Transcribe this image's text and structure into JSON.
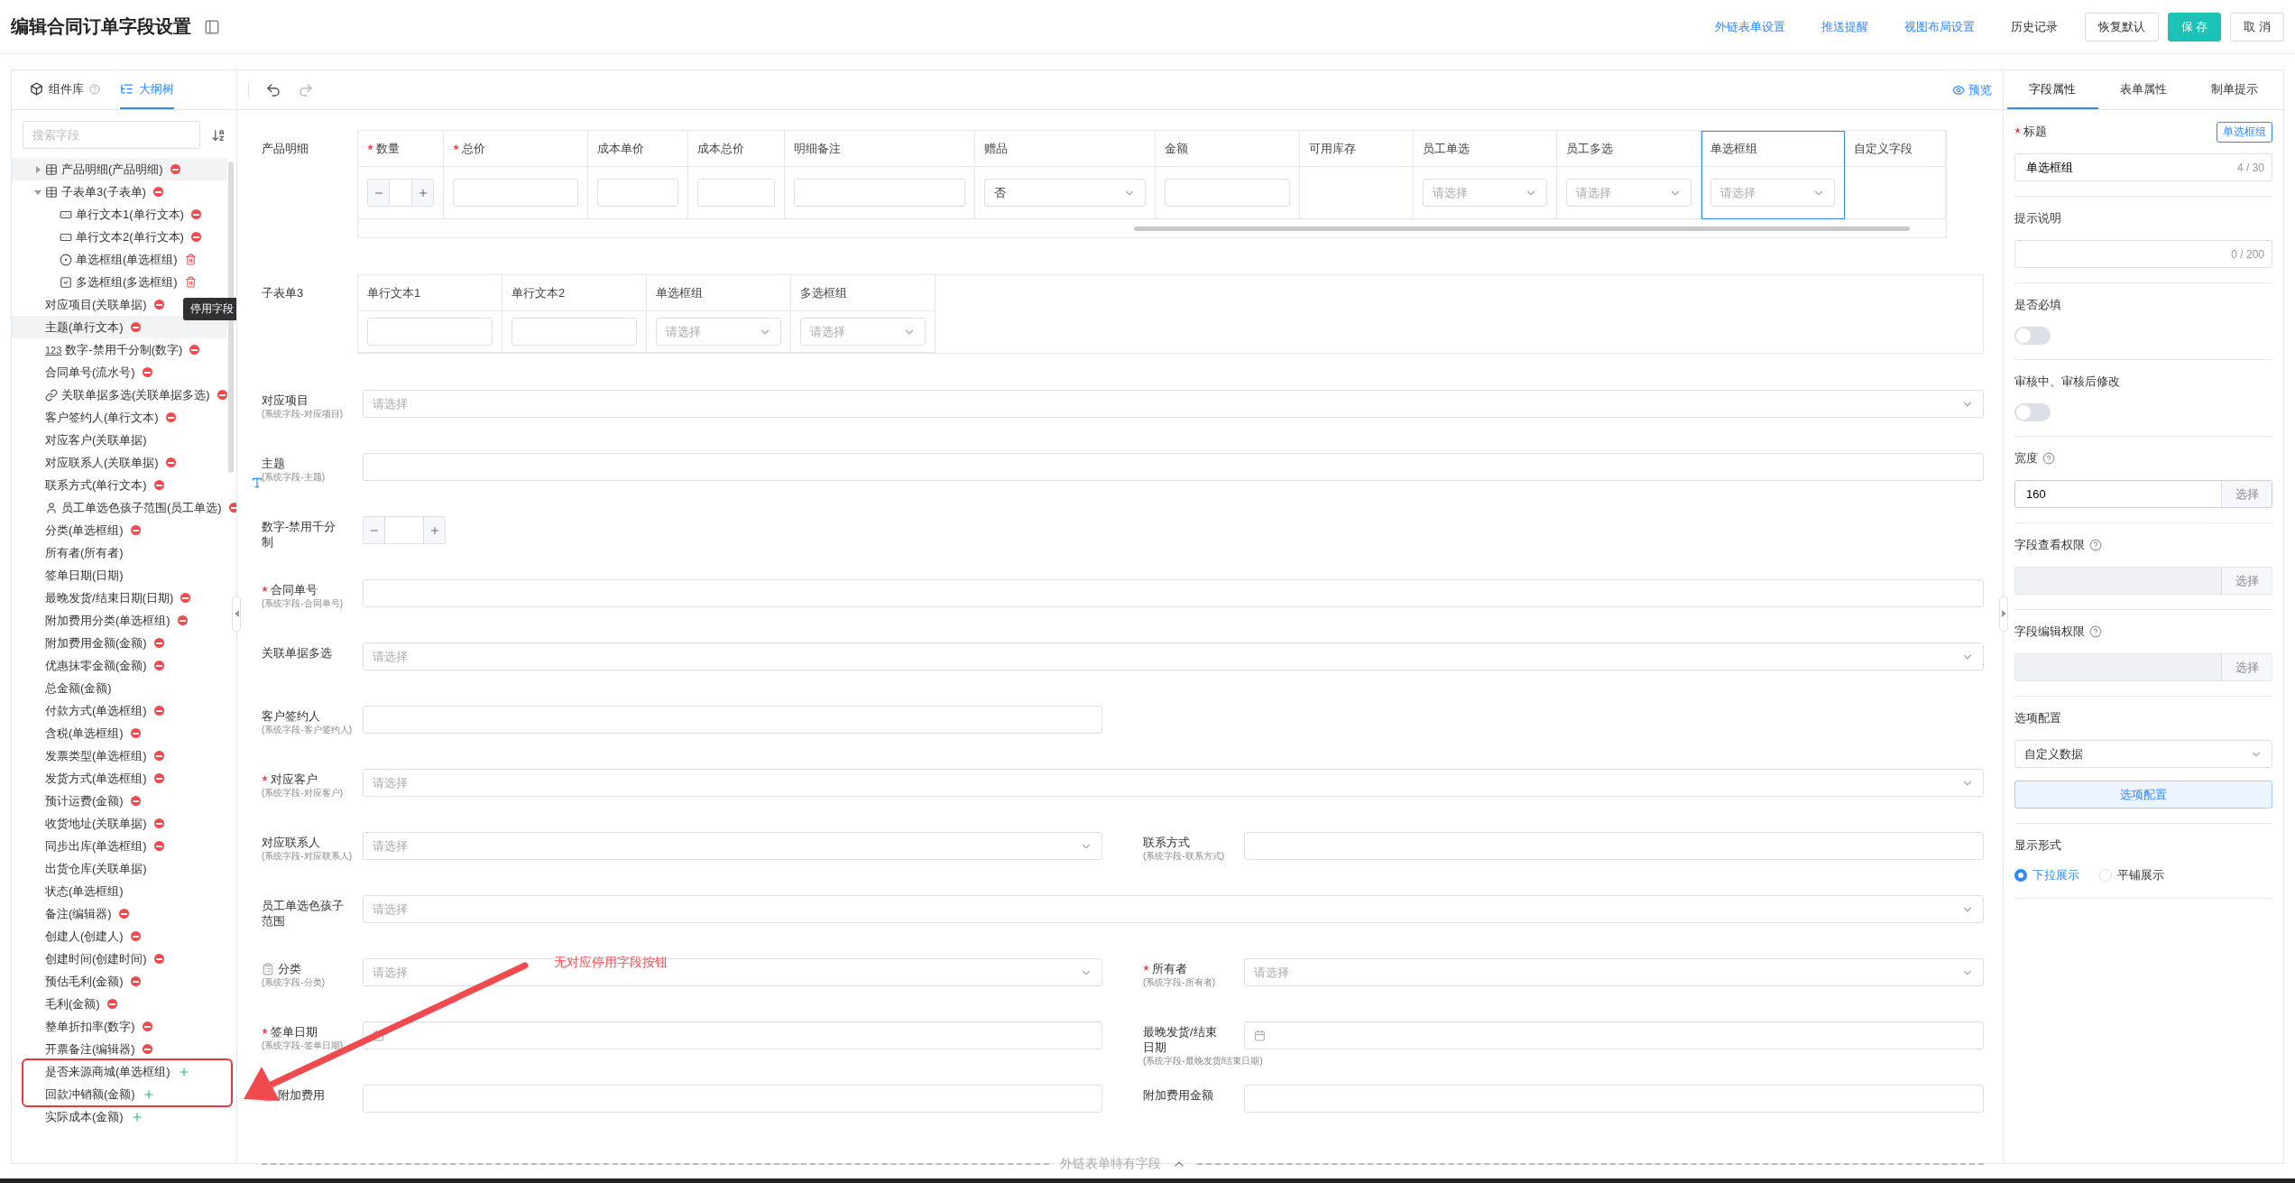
{
  "header": {
    "title": "编辑合同订单字段设置",
    "links": [
      "外链表单设置",
      "推送提醒",
      "视图布局设置"
    ],
    "history": "历史记录",
    "buttons": [
      {
        "label": "恢复默认",
        "kind": "default"
      },
      {
        "label": "保 存",
        "kind": "primary"
      },
      {
        "label": "取 消",
        "kind": "default"
      }
    ]
  },
  "left_panel": {
    "tabs": [
      {
        "label": "组件库",
        "selected": false,
        "help": true
      },
      {
        "label": "大纲树",
        "selected": true,
        "help": false
      }
    ],
    "search": {
      "placeholder": "搜索字段"
    },
    "tree": [
      {
        "label": "产品明细(产品明细)",
        "kind": "table",
        "action": {
          "kind": "disable"
        },
        "highlighted": true,
        "boxed": false,
        "expanded": false
      },
      {
        "label": "子表单3(子表单)",
        "kind": "table",
        "action": {
          "kind": "disable"
        },
        "highlighted": false,
        "boxed": false,
        "expanded": true,
        "children": [
          {
            "label": "单行文本1(单行文本)",
            "kind": "text",
            "action": {
              "kind": "disable"
            },
            "highlighted": false,
            "boxed": false
          },
          {
            "label": "单行文本2(单行文本)",
            "kind": "text",
            "action": {
              "kind": "disable"
            },
            "highlighted": false,
            "boxed": false
          },
          {
            "label": "单选框组(单选框组)",
            "kind": "radio",
            "action": {
              "kind": "delete"
            },
            "highlighted": false,
            "boxed": false
          },
          {
            "label": "多选框组(多选框组)",
            "kind": "checkbox",
            "action": {
              "kind": "delete"
            },
            "highlighted": false,
            "boxed": false
          }
        ]
      },
      {
        "label": "对应项目(关联单据)",
        "kind": "plain",
        "action": {
          "kind": "disable"
        },
        "highlighted": false,
        "boxed": false
      },
      {
        "label": "主题(单行文本)",
        "kind": "plain",
        "action": {
          "kind": "disable"
        },
        "highlighted": true,
        "boxed": false,
        "tooltip": "停用字段"
      },
      {
        "label": "数字-禁用千分制(数字)",
        "kind": "number",
        "glyph": "123",
        "action": {
          "kind": "disable"
        },
        "highlighted": false,
        "boxed": false
      },
      {
        "label": "合同单号(流水号)",
        "kind": "plain",
        "action": {
          "kind": "disable"
        },
        "highlighted": false,
        "boxed": false
      },
      {
        "label": "关联单据多选(关联单据多选)",
        "kind": "link",
        "action": {
          "kind": "disable"
        },
        "highlighted": false,
        "boxed": false
      },
      {
        "label": "客户签约人(单行文本)",
        "kind": "plain",
        "action": {
          "kind": "disable"
        },
        "highlighted": false,
        "boxed": false
      },
      {
        "label": "对应客户(关联单据)",
        "kind": "plain",
        "highlighted": false,
        "boxed": false
      },
      {
        "label": "对应联系人(关联单据)",
        "kind": "plain",
        "action": {
          "kind": "disable"
        },
        "highlighted": false,
        "boxed": false
      },
      {
        "label": "联系方式(单行文本)",
        "kind": "plain",
        "action": {
          "kind": "disable"
        },
        "highlighted": false,
        "boxed": false
      },
      {
        "label": "员工单选色孩子范围(员工单选)",
        "kind": "user",
        "action": {
          "kind": "disable"
        },
        "highlighted": false,
        "boxed": false
      },
      {
        "label": "分类(单选框组)",
        "kind": "plain",
        "action": {
          "kind": "disable"
        },
        "highlighted": false,
        "boxed": false
      },
      {
        "label": "所有者(所有者)",
        "kind": "plain",
        "highlighted": false,
        "boxed": false
      },
      {
        "label": "签单日期(日期)",
        "kind": "plain",
        "highlighted": false,
        "boxed": false
      },
      {
        "label": "最晚发货/结束日期(日期)",
        "kind": "plain",
        "action": {
          "kind": "disable"
        },
        "highlighted": false,
        "boxed": false
      },
      {
        "label": "附加费用分类(单选框组)",
        "kind": "plain",
        "action": {
          "kind": "disable"
        },
        "highlighted": false,
        "boxed": false
      },
      {
        "label": "附加费用金额(金额)",
        "kind": "plain",
        "action": {
          "kind": "disable"
        },
        "highlighted": false,
        "boxed": false
      },
      {
        "label": "优惠抹零金额(金额)",
        "kind": "plain",
        "action": {
          "kind": "disable"
        },
        "highlighted": false,
        "boxed": false
      },
      {
        "label": "总金额(金额)",
        "kind": "plain",
        "highlighted": false,
        "boxed": false
      },
      {
        "label": "付款方式(单选框组)",
        "kind": "plain",
        "action": {
          "kind": "disable"
        },
        "highlighted": false,
        "boxed": false
      },
      {
        "label": "含税(单选框组)",
        "kind": "plain",
        "action": {
          "kind": "disable"
        },
        "highlighted": false,
        "boxed": false
      },
      {
        "label": "发票类型(单选框组)",
        "kind": "plain",
        "action": {
          "kind": "disable"
        },
        "highlighted": false,
        "boxed": false
      },
      {
        "label": "发货方式(单选框组)",
        "kind": "plain",
        "action": {
          "kind": "disable"
        },
        "highlighted": false,
        "boxed": false
      },
      {
        "label": "预计运费(金额)",
        "kind": "plain",
        "action": {
          "kind": "disable"
        },
        "highlighted": false,
        "boxed": false
      },
      {
        "label": "收货地址(关联单据)",
        "kind": "plain",
        "action": {
          "kind": "disable"
        },
        "highlighted": false,
        "boxed": false
      },
      {
        "label": "同步出库(单选框组)",
        "kind": "plain",
        "action": {
          "kind": "disable"
        },
        "highlighted": false,
        "boxed": false
      },
      {
        "label": "出货仓库(关联单据)",
        "kind": "plain",
        "highlighted": false,
        "boxed": false
      },
      {
        "label": "状态(单选框组)",
        "kind": "plain",
        "highlighted": false,
        "boxed": false
      },
      {
        "label": "备注(编辑器)",
        "kind": "plain",
        "action": {
          "kind": "disable"
        },
        "highlighted": false,
        "boxed": false
      },
      {
        "label": "创建人(创建人)",
        "kind": "plain",
        "action": {
          "kind": "disable"
        },
        "highlighted": false,
        "boxed": false
      },
      {
        "label": "创建时间(创建时间)",
        "kind": "plain",
        "action": {
          "kind": "disable"
        },
        "highlighted": false,
        "boxed": false
      },
      {
        "label": "预估毛利(金额)",
        "kind": "plain",
        "action": {
          "kind": "disable"
        },
        "highlighted": false,
        "boxed": false
      },
      {
        "label": "毛利(金额)",
        "kind": "plain",
        "action": {
          "kind": "disable"
        },
        "highlighted": false,
        "boxed": false
      },
      {
        "label": "整单折扣率(数字)",
        "kind": "plain",
        "action": {
          "kind": "disable"
        },
        "highlighted": false,
        "boxed": false
      },
      {
        "label": "开票备注(编辑器)",
        "kind": "plain",
        "action": {
          "kind": "disable"
        },
        "highlighted": false,
        "boxed": false
      },
      {
        "label": "是否来源商城(单选框组)",
        "kind": "plain",
        "action": {
          "kind": "enable"
        },
        "highlighted": false,
        "boxed": true
      },
      {
        "label": "回款冲销额(金额)",
        "kind": "plain",
        "action": {
          "kind": "enable"
        },
        "highlighted": false,
        "boxed": true
      },
      {
        "label": "实际成本(金额)",
        "kind": "plain",
        "action": {
          "kind": "enable"
        },
        "highlighted": false,
        "boxed": false
      }
    ]
  },
  "center": {
    "preview": "预览",
    "product_table": {
      "label": "产品明细",
      "columns": [
        {
          "label": "数量",
          "required": true,
          "kind": "stepper",
          "selected": false
        },
        {
          "label": "总价",
          "required": true,
          "kind": "input",
          "selected": false
        },
        {
          "label": "成本单价",
          "required": false,
          "kind": "input",
          "selected": false
        },
        {
          "label": "成本总价",
          "required": false,
          "kind": "input",
          "selected": false
        },
        {
          "label": "明细备注",
          "required": false,
          "kind": "input",
          "selected": false
        },
        {
          "label": "赠品",
          "required": false,
          "kind": "select",
          "value": "否",
          "selected": false
        },
        {
          "label": "金额",
          "required": false,
          "kind": "input",
          "selected": false
        },
        {
          "label": "可用库存",
          "required": false,
          "kind": "empty",
          "selected": false
        },
        {
          "label": "员工单选",
          "required": false,
          "kind": "select",
          "placeholder": "请选择",
          "selected": false
        },
        {
          "label": "员工多选",
          "required": false,
          "kind": "select",
          "placeholder": "请选择",
          "selected": false
        },
        {
          "label": "单选框组",
          "required": false,
          "kind": "select",
          "placeholder": "请选择",
          "selected": true
        },
        {
          "label": "自定义字段",
          "required": false,
          "kind": "empty",
          "selected": false
        }
      ]
    },
    "subtable": {
      "label": "子表单3",
      "columns": [
        {
          "label": "单行文本1",
          "required": false,
          "kind": "input",
          "selected": false
        },
        {
          "label": "单行文本2",
          "required": false,
          "kind": "input",
          "selected": false
        },
        {
          "label": "单选框组",
          "required": false,
          "kind": "select",
          "placeholder": "请选择",
          "selected": false
        },
        {
          "label": "多选框组",
          "required": false,
          "kind": "select",
          "placeholder": "请选择",
          "selected": false
        }
      ]
    },
    "rows": [
      {
        "fields": [
          {
            "label": "对应项目",
            "sublabel": "(系统字段-对应项目)",
            "required": false,
            "icon": false,
            "kind": "select",
            "placeholder": "请选择",
            "wide": true
          }
        ]
      },
      {
        "fields": [
          {
            "label": "主题",
            "sublabel": "(系统字段-主题)",
            "required": false,
            "icon": false,
            "kind": "input",
            "wide": true
          }
        ]
      },
      {
        "fields": [
          {
            "label": "数字-禁用千分制",
            "required": false,
            "icon": false,
            "kind": "stepper",
            "wide": true
          }
        ]
      },
      {
        "fields": [
          {
            "label": "合同单号",
            "sublabel": "(系统字段-合同单号)",
            "required": true,
            "icon": false,
            "kind": "input",
            "wide": true
          }
        ]
      },
      {
        "fields": [
          {
            "label": "关联单据多选",
            "required": false,
            "icon": false,
            "kind": "select",
            "placeholder": "请选择",
            "wide": true
          }
        ]
      },
      {
        "fields": [
          {
            "label": "客户签约人",
            "sublabel": "(系统字段-客户签约人)",
            "required": false,
            "icon": false,
            "kind": "input",
            "wide": false
          }
        ]
      },
      {
        "fields": [
          {
            "label": "对应客户",
            "sublabel": "(系统字段-对应客户)",
            "required": true,
            "icon": false,
            "kind": "select",
            "placeholder": "请选择",
            "wide": true
          }
        ]
      },
      {
        "fields": [
          {
            "label": "对应联系人",
            "sublabel": "(系统字段-对应联系人)",
            "required": false,
            "icon": false,
            "kind": "select",
            "placeholder": "请选择",
            "wide": false
          },
          {
            "label": "联系方式",
            "sublabel": "(系统字段-联系方式)",
            "required": false,
            "icon": false,
            "kind": "input",
            "wide": false
          }
        ]
      },
      {
        "fields": [
          {
            "label": "员工单选色孩子范围",
            "required": false,
            "icon": false,
            "kind": "select",
            "placeholder": "请选择",
            "wide": true
          }
        ]
      },
      {
        "fields": [
          {
            "label": "分类",
            "sublabel": "(系统字段-分类)",
            "required": false,
            "icon": true,
            "kind": "select",
            "placeholder": "请选择",
            "wide": false
          },
          {
            "label": "所有者",
            "sublabel": "(系统字段-所有者)",
            "required": true,
            "icon": false,
            "kind": "select",
            "placeholder": "请选择",
            "wide": false
          }
        ]
      },
      {
        "fields": [
          {
            "label": "签单日期",
            "sublabel": "(系统字段-签单日期)",
            "required": true,
            "icon": false,
            "kind": "date",
            "wide": false
          },
          {
            "label": "最晚发货/结束日期",
            "sublabel": "(系统字段-最晚发货/结束日期)",
            "required": false,
            "icon": false,
            "kind": "date",
            "wide": false
          }
        ]
      },
      {
        "fields": [
          {
            "label": "附加费用",
            "required": false,
            "icon": true,
            "kind": "input",
            "wide": false
          },
          {
            "label": "附加费用金额",
            "required": false,
            "icon": false,
            "kind": "input",
            "wide": false
          }
        ]
      }
    ],
    "divider": "外链表单特有字段"
  },
  "annotation": "无对应停用字段按钮",
  "right_panel": {
    "tabs": [
      {
        "label": "字段属性",
        "selected": true
      },
      {
        "label": "表单属性",
        "selected": false
      },
      {
        "label": "制单提示",
        "selected": false
      }
    ],
    "sections": [
      {
        "kind": "text",
        "label": "标题",
        "required": true,
        "tag": "单选框组",
        "value": "单选框组",
        "counter": "4 / 30"
      },
      {
        "kind": "text",
        "label": "提示说明",
        "required": false,
        "counter": "0 / 200"
      },
      {
        "kind": "toggle",
        "label": "是否必填",
        "on": false
      },
      {
        "kind": "toggle",
        "label": "审核中、审核后修改",
        "on": false
      },
      {
        "kind": "addon",
        "label": "宽度",
        "value": "160",
        "addon": "选择",
        "disabled": false
      },
      {
        "kind": "addon",
        "label": "字段查看权限",
        "addon": "选择",
        "disabled": true
      },
      {
        "kind": "addon",
        "label": "字段编辑权限",
        "addon": "选择",
        "disabled": true
      },
      {
        "kind": "options",
        "label": "选项配置",
        "value": "自定义数据",
        "button": "选项配置"
      },
      {
        "kind": "radio",
        "label": "显示形式",
        "options": [
          {
            "label": "下拉展示",
            "selected": true
          },
          {
            "label": "平铺展示",
            "selected": false
          }
        ]
      }
    ]
  }
}
